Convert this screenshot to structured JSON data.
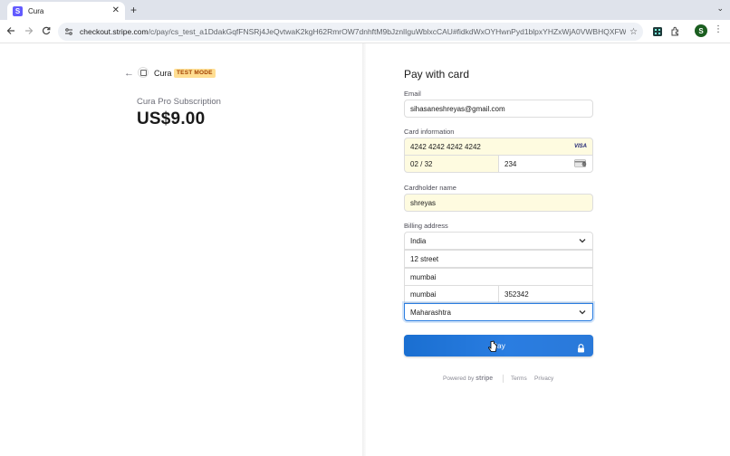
{
  "browser": {
    "tab_title": "Cura",
    "tab_favicon_letter": "S",
    "tab_close": "✕",
    "new_tab": "+",
    "tab_menu": "⌄",
    "url_host": "checkout.stripe.com",
    "url_path": "/c/pay/cs_test_a1DdakGqfFNSRj4JeQvtwaK2kgH62RmrOW7dnhftM9bJznlIguWblxcCAU#fidkdWxOYHwnPyd1blpxYHZxWjA0VWBHQXFWQmg...",
    "profile_letter": "S"
  },
  "merchant": {
    "name": "Cura",
    "badge": "TEST MODE"
  },
  "product": {
    "name": "Cura Pro Subscription",
    "price": "US$9.00"
  },
  "form": {
    "title": "Pay with card",
    "email_label": "Email",
    "email_value": "sihasaneshreyas@gmail.com",
    "card_label": "Card information",
    "card_number": "4242 4242 4242 4242",
    "card_brand": "VISA",
    "card_expiry": "02 / 32",
    "card_cvc": "234",
    "name_label": "Cardholder name",
    "name_value": "shreyas",
    "billing_label": "Billing address",
    "country": "India",
    "address_line1": "12 street",
    "city": "mumbai",
    "locality": "mumbai",
    "postal_code": "352342",
    "state": "Maharashtra",
    "pay_label": "Pay"
  },
  "footer": {
    "powered_prefix": "Powered by",
    "powered_brand": "stripe",
    "terms": "Terms",
    "privacy": "Privacy"
  },
  "colors": {
    "accent": "#2a7de1",
    "autofill": "#fefbe0",
    "badge": "#ffde92"
  }
}
